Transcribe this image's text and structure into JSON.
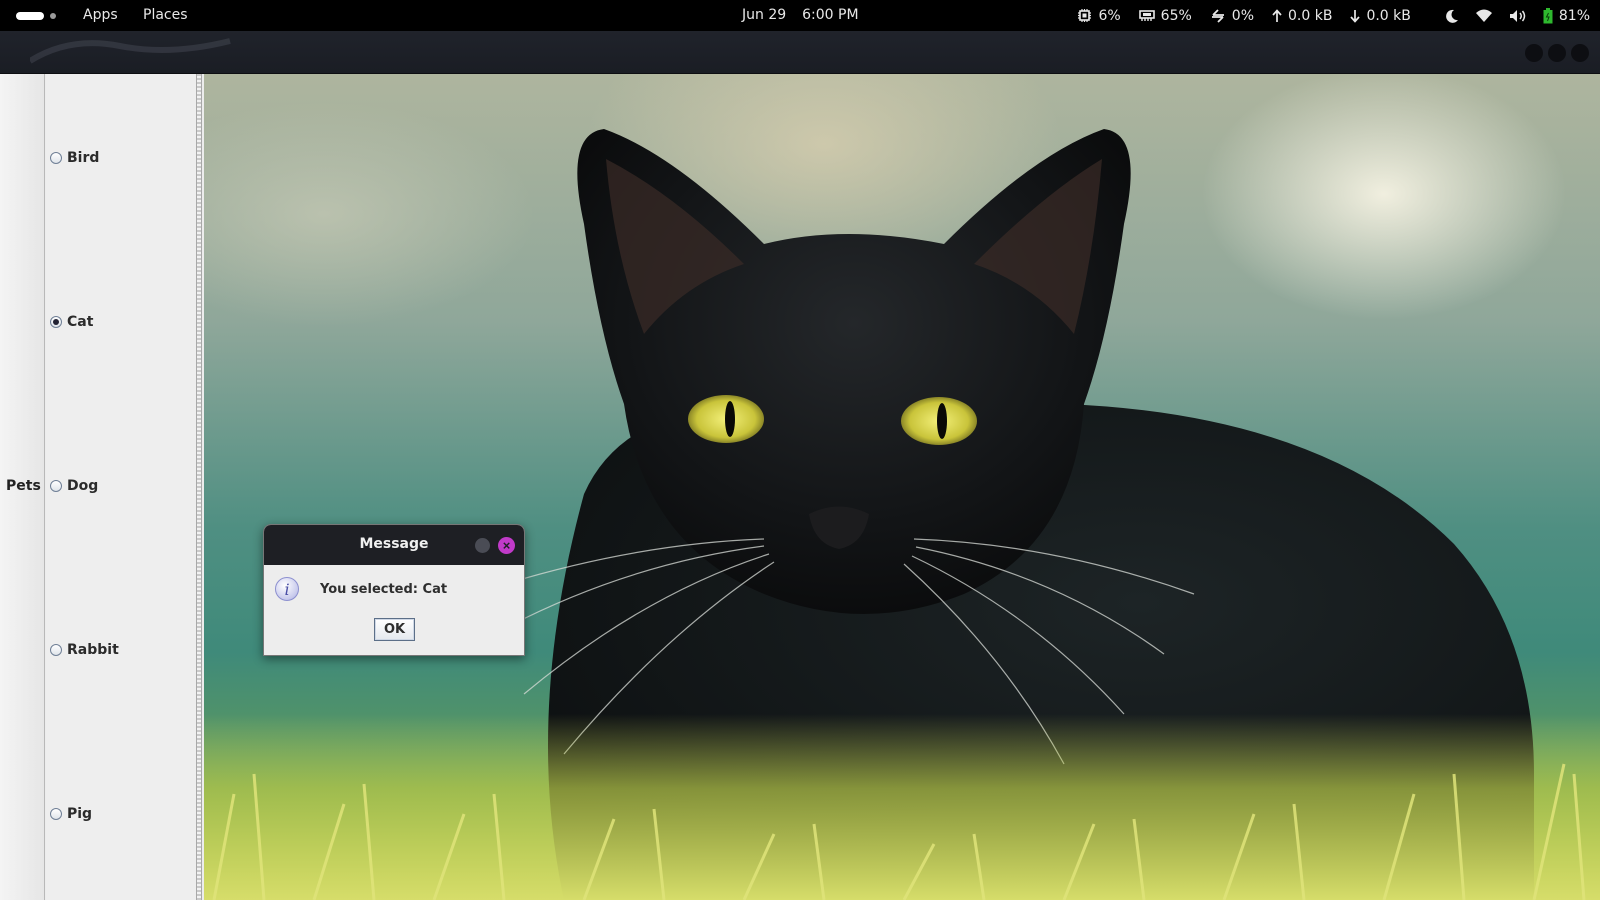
{
  "topbar": {
    "apps_label": "Apps",
    "places_label": "Places",
    "date": "Jun 29",
    "time": "6:00 PM",
    "cpu": "6%",
    "memory": "65%",
    "swap": "0%",
    "upload": "0.0 kB",
    "download": "0.0 kB",
    "battery": "81%",
    "icons": [
      "cpu-icon",
      "memory-icon",
      "swap-icon",
      "upload-icon",
      "download-icon",
      "night-light-icon",
      "wifi-icon",
      "volume-icon",
      "battery-icon"
    ]
  },
  "sidebar": {
    "group_label": "Pets",
    "options": [
      {
        "label": "Bird",
        "checked": false
      },
      {
        "label": "Cat",
        "checked": true
      },
      {
        "label": "Dog",
        "checked": false
      },
      {
        "label": "Rabbit",
        "checked": false
      },
      {
        "label": "Pig",
        "checked": false
      }
    ]
  },
  "dialog": {
    "title": "Message",
    "message": "You selected: Cat",
    "ok_label": "OK",
    "close_glyph": "×",
    "info_glyph": "i"
  },
  "colors": {
    "accent_close": "#c13ac9",
    "battery": "#2eb82e"
  }
}
